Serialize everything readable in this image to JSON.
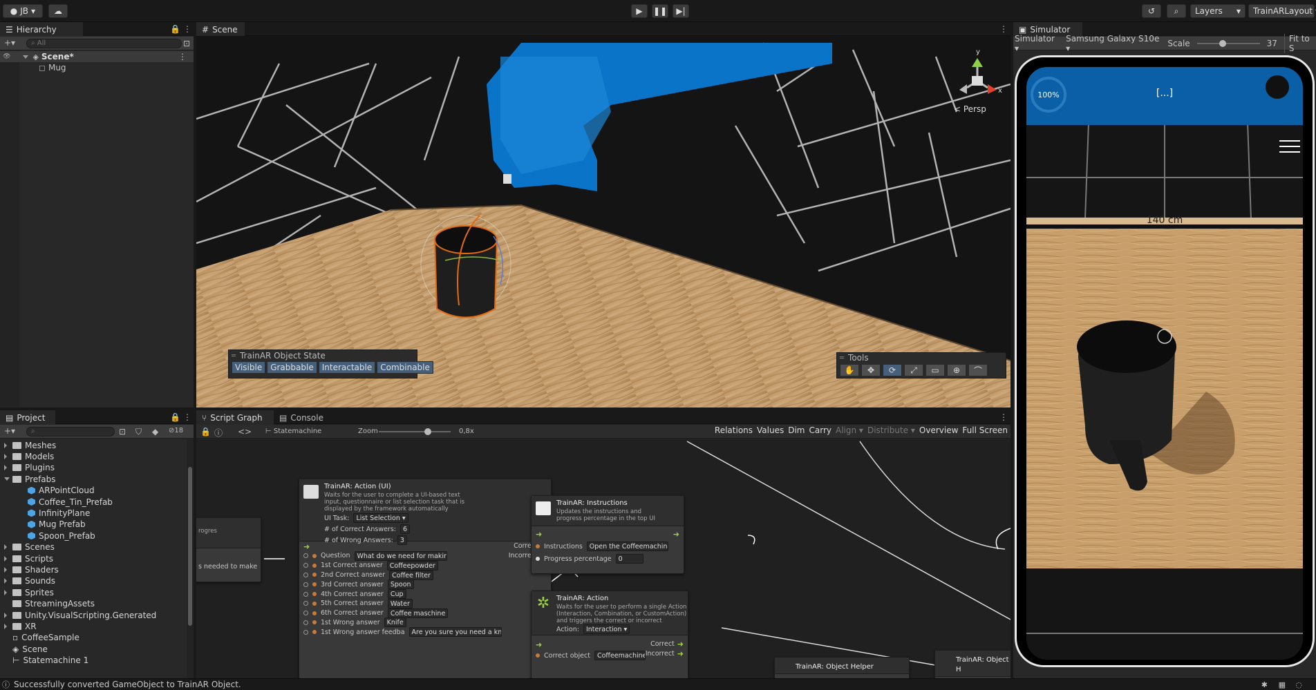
{
  "toolbar": {
    "account_label": "JB",
    "layers_label": "Layers",
    "layout_label": "TrainARLayout"
  },
  "hierarchy": {
    "tab_label": "Hierarchy",
    "search_placeholder": "All",
    "scene_label": "Scene*",
    "items": [
      "Mug"
    ]
  },
  "scene": {
    "tab_label": "Scene",
    "persp_label": "< Persp",
    "gizmo_y": "y",
    "gizmo_x": "x",
    "object_state": {
      "title": "TrainAR Object State",
      "buttons": [
        "Visible",
        "Grabbable",
        "Interactable",
        "Combinable"
      ]
    },
    "tools_title": "Tools"
  },
  "simulator": {
    "tab_label": "Simulator",
    "mode_label": "Simulator",
    "device_label": "Samsung Galaxy S10e",
    "scale_label": "Scale",
    "scale_value": "37",
    "fit_label": "Fit to S",
    "progress_label": "100%",
    "instruction_label": "[...]",
    "measure_label": "140 cm"
  },
  "project": {
    "tab_label": "Project",
    "hidden_count": "18",
    "items": [
      {
        "label": "Meshes",
        "type": "folder",
        "indent": 0,
        "arrow": "closed"
      },
      {
        "label": "Models",
        "type": "folder",
        "indent": 0,
        "arrow": "closed"
      },
      {
        "label": "Plugins",
        "type": "folder",
        "indent": 0,
        "arrow": "closed"
      },
      {
        "label": "Prefabs",
        "type": "folder",
        "indent": 0,
        "arrow": "open"
      },
      {
        "label": "ARPointCloud",
        "type": "prefab",
        "indent": 1,
        "arrow": "none"
      },
      {
        "label": "Coffee_Tin_Prefab",
        "type": "prefab",
        "indent": 1,
        "arrow": "none"
      },
      {
        "label": "InfinityPlane",
        "type": "prefab",
        "indent": 1,
        "arrow": "none"
      },
      {
        "label": "Mug Prefab",
        "type": "prefab",
        "indent": 1,
        "arrow": "none"
      },
      {
        "label": "Spoon_Prefab",
        "type": "prefab",
        "indent": 1,
        "arrow": "none"
      },
      {
        "label": "Scenes",
        "type": "folder",
        "indent": 0,
        "arrow": "closed"
      },
      {
        "label": "Scripts",
        "type": "folder",
        "indent": 0,
        "arrow": "closed"
      },
      {
        "label": "Shaders",
        "type": "folder",
        "indent": 0,
        "arrow": "closed"
      },
      {
        "label": "Sounds",
        "type": "folder",
        "indent": 0,
        "arrow": "closed"
      },
      {
        "label": "Sprites",
        "type": "folder",
        "indent": 0,
        "arrow": "closed"
      },
      {
        "label": "StreamingAssets",
        "type": "folder",
        "indent": 0,
        "arrow": "none"
      },
      {
        "label": "Unity.VisualScripting.Generated",
        "type": "folder",
        "indent": 0,
        "arrow": "closed"
      },
      {
        "label": "XR",
        "type": "folder",
        "indent": 0,
        "arrow": "closed"
      },
      {
        "label": "CoffeeSample",
        "type": "asset",
        "indent": 0,
        "arrow": "none"
      },
      {
        "label": "Scene",
        "type": "scene",
        "indent": 0,
        "arrow": "none"
      },
      {
        "label": "Statemachine 1",
        "type": "graph",
        "indent": 0,
        "arrow": "none"
      }
    ]
  },
  "graph": {
    "tab_script_graph": "Script Graph",
    "tab_console": "Console",
    "breadcrumb": "Statemachine",
    "zoom_label": "Zoom",
    "zoom_value": "0,8x",
    "buttons": [
      "Relations",
      "Values",
      "Dim",
      "Carry",
      "Align",
      "Distribute",
      "Overview",
      "Full Screen"
    ],
    "left_node": {
      "text1": "rogres",
      "text2": "s needed to make"
    },
    "action_ui": {
      "title": "TrainAR: Action (UI)",
      "desc": "Waits for the user to complete a UI-based text input, questionnaire or list selection task that is displayed by the framework automatically",
      "ui_task_label": "UI Task:",
      "ui_task_value": "List Selection",
      "correct_count_label": "# of Correct Answers:",
      "correct_count_value": "6",
      "wrong_count_label": "# of Wrong Answers:",
      "wrong_count_value": "3",
      "correct_port": "Correct",
      "incorrect_port": "Incorrect",
      "fields": [
        {
          "label": "Question",
          "value": "What do we need for making coffe"
        },
        {
          "label": "1st Correct answer",
          "value": "Coffeepowder"
        },
        {
          "label": "2nd Correct answer",
          "value": "Coffee filter"
        },
        {
          "label": "3rd Correct answer",
          "value": "Spoon"
        },
        {
          "label": "4th Correct answer",
          "value": "Cup"
        },
        {
          "label": "5th Correct answer",
          "value": "Water"
        },
        {
          "label": "6th Correct answer",
          "value": "Coffee maschine"
        },
        {
          "label": "1st Wrong answer",
          "value": "Knife"
        },
        {
          "label": "1st Wrong answer feedba",
          "value": "Are you sure you need a knife to m"
        }
      ]
    },
    "instructions": {
      "title": "TrainAR: Instructions",
      "desc": "Updates the instructions and progress percentage in the top UI panel",
      "instructions_label": "Instructions",
      "instructions_value": "Open the Coffeemachine",
      "progress_label": "Progress percentage",
      "progress_value": "0"
    },
    "action": {
      "title": "TrainAR: Action",
      "desc": "Waits for the user to perform a single Action (Interaction, Combination, or CustomAction) and triggers the correct or incorrect stateflow output",
      "action_label": "Action:",
      "action_value": "Interaction",
      "correct_port": "Correct",
      "incorrect_port": "Incorrect",
      "object_label": "Correct object",
      "object_value": "Coffeemachine"
    },
    "helper_title": "TrainAR: Object Helper",
    "right_node_title": "TrainAR: Object H"
  },
  "status": {
    "message": "Successfully converted GameObject to TrainAR Object."
  }
}
